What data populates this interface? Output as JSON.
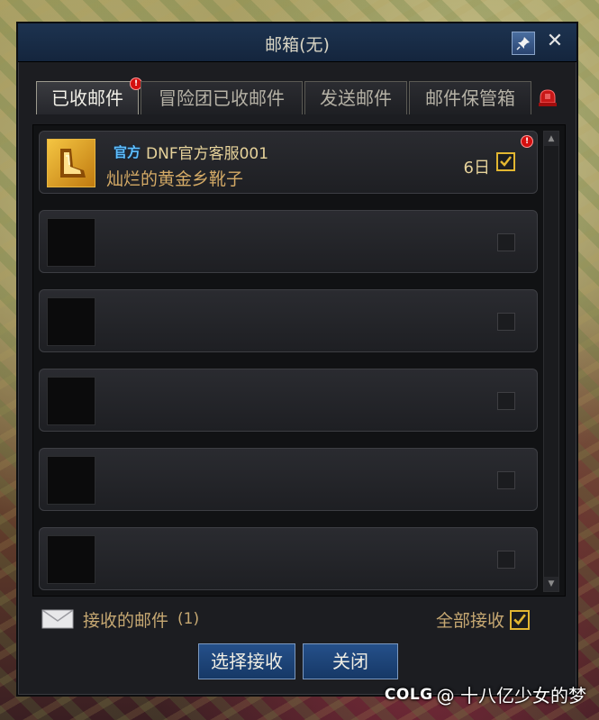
{
  "window": {
    "title": "邮箱(无)",
    "close_glyph": "✕"
  },
  "tabs": [
    {
      "label": "已收邮件",
      "active": true,
      "has_alert": true
    },
    {
      "label": "冒险团已收邮件",
      "active": false
    },
    {
      "label": "发送邮件",
      "active": false
    },
    {
      "label": "邮件保管箱",
      "active": false
    }
  ],
  "mails": [
    {
      "tag": "官方",
      "sender": "DNF官方客服001",
      "subject": "灿烂的黄金乡靴子",
      "days_left": "6日",
      "checked": true,
      "unread_alert": true
    }
  ],
  "empty_rows": 5,
  "footer": {
    "received_label": "接收的邮件",
    "received_count": "(1)",
    "select_all_label": "全部接收",
    "select_all_checked": true
  },
  "buttons": {
    "select_receive": "选择接收",
    "close": "关闭"
  },
  "watermark": {
    "logo": "COLG",
    "text": "@ 十八亿少女的梦"
  },
  "colors": {
    "accent_gold": "#e2b631",
    "title_bar": "#1d3350",
    "alert_red": "#d40f0f"
  },
  "icons": {
    "pin": "pin-icon",
    "close": "close-icon",
    "bell": "alarm-bell-icon",
    "envelope": "envelope-icon",
    "alert": "exclamation-icon"
  }
}
